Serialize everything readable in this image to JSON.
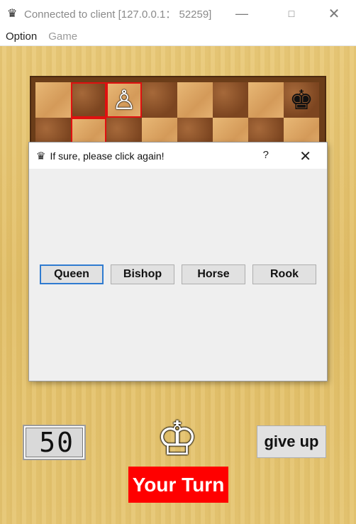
{
  "window": {
    "title": "Connected to client [127.0.0.1： 52259]",
    "icon": "queen-icon",
    "controls": [
      "minimize",
      "maximize",
      "close"
    ]
  },
  "menu": {
    "items": [
      {
        "label": "Option",
        "enabled": true
      },
      {
        "label": "Game",
        "enabled": false
      }
    ]
  },
  "board": {
    "visible_rows": [
      [
        "",
        "",
        "♙",
        "",
        "",
        "",
        "",
        "♚"
      ],
      [
        "",
        "",
        "",
        "",
        "",
        "",
        "",
        ""
      ]
    ],
    "highlighted_squares": [
      "b1",
      "c1",
      "b2"
    ]
  },
  "dialog": {
    "icon": "queen-icon",
    "title": "If sure, please click again!",
    "help_label": "?",
    "close_label": "✕",
    "buttons": [
      {
        "label": "Queen",
        "focused": true
      },
      {
        "label": "Bishop",
        "focused": false
      },
      {
        "label": "Horse",
        "focused": false
      },
      {
        "label": "Rook",
        "focused": false
      }
    ]
  },
  "status": {
    "timer": "50",
    "player_piece": "♔",
    "give_up_label": "give up",
    "turn_label": "Your Turn",
    "turn_color": "#ff0000"
  }
}
